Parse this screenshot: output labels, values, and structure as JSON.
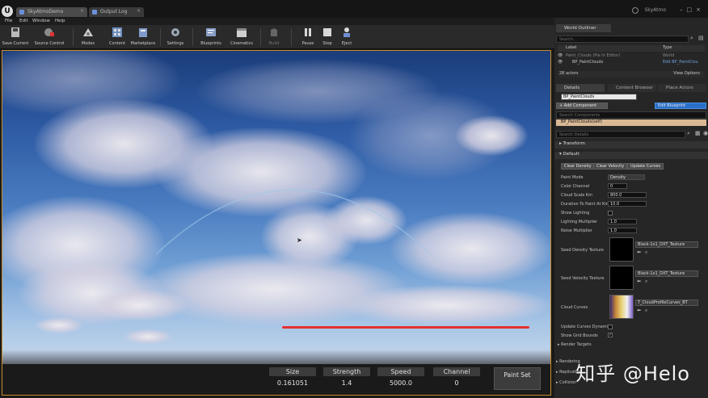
{
  "titlebar": {
    "tabs": [
      {
        "label": "SkyAtmoDemo"
      },
      {
        "label": "Output Log"
      }
    ],
    "project": "SkyAtmo"
  },
  "menu": [
    "File",
    "Edit",
    "Window",
    "Help"
  ],
  "toolbar": {
    "buttons": [
      {
        "label": "Save Current"
      },
      {
        "label": "Source Control"
      },
      {
        "label": "Modes"
      },
      {
        "label": "Content"
      },
      {
        "label": "Marketplace"
      },
      {
        "label": "Settings"
      },
      {
        "label": "Blueprints"
      },
      {
        "label": "Cinematics"
      },
      {
        "label": "Build"
      },
      {
        "label": "Pause"
      },
      {
        "label": "Stop"
      },
      {
        "label": "Eject"
      }
    ]
  },
  "viewport": {
    "hud": {
      "size_label": "Size",
      "size_value": "0.161051",
      "strength_label": "Strength",
      "strength_value": "1.4",
      "speed_label": "Speed",
      "speed_value": "5000.0",
      "channel_label": "Channel",
      "channel_value": "0",
      "paint_set_label": "Paint Set"
    }
  },
  "world_outliner": {
    "tab": "World Outliner",
    "search_placeholder": "Search...",
    "col_label": "Label",
    "col_type": "Type",
    "rows": [
      {
        "label": "Paint_Clouds (Pie In Editor)",
        "type": "World"
      },
      {
        "label": "BP_PaintClouds",
        "type": "Edit BP_PaintClou"
      }
    ],
    "actor_count": "28 actors",
    "view_options": "View Options"
  },
  "details": {
    "tabs": [
      "Details",
      "Content Browser",
      "Place Actors"
    ],
    "actor_name": "BP_PaintClouds",
    "add_component": "+ Add Component",
    "edit_blueprint": "Edit Blueprint",
    "search_components": "Search Components",
    "component_self": "BP_PaintClouds(self)",
    "search_details": "Search Details",
    "section_transform": "Transform",
    "section_default": "Default",
    "buttons": [
      "Clear Density",
      "Clear Velocity",
      "Update Curves"
    ],
    "props": {
      "paint_mode": {
        "label": "Paint Mode",
        "value": "Density"
      },
      "color_channel": {
        "label": "Color Channel",
        "value": "0"
      },
      "cloud_scale_km": {
        "label": "Cloud Scale Km",
        "value": "800.0"
      },
      "duration_to_paint": {
        "label": "Duration To Paint At Kin",
        "value": "10.0"
      },
      "show_lighting": {
        "label": "Show Lighting"
      },
      "lighting_multiplier": {
        "label": "Lighting Multiplier",
        "value": "1.0"
      },
      "noise_multiplier": {
        "label": "Noise Multiplier",
        "value": "1.0"
      },
      "seed_density_texture": {
        "label": "Seed Density Texture",
        "asset": "Black-1x1_DXT_Texture"
      },
      "seed_velocity_texture": {
        "label": "Seed Velocity Texture",
        "asset": "Black-1x1_DXT_Texture"
      },
      "cloud_curves": {
        "label": "Cloud Curves",
        "asset": "T_CloudProfileCurves_BT"
      },
      "update_curves_dynamics": {
        "label": "Update Curves Dynamics"
      },
      "show_grid_bounds": {
        "label": "Show Grid Bounds"
      }
    },
    "section_render_targets": "Render Targets",
    "section_rendering": "Rendering",
    "section_replication": "Replication",
    "section_collision": "Collision"
  },
  "watermark": "知乎 @Helo",
  "colors": {
    "accent": "#c58d2a",
    "blueprint_btn": "#2a6fc9",
    "red_line": "#e53030"
  }
}
